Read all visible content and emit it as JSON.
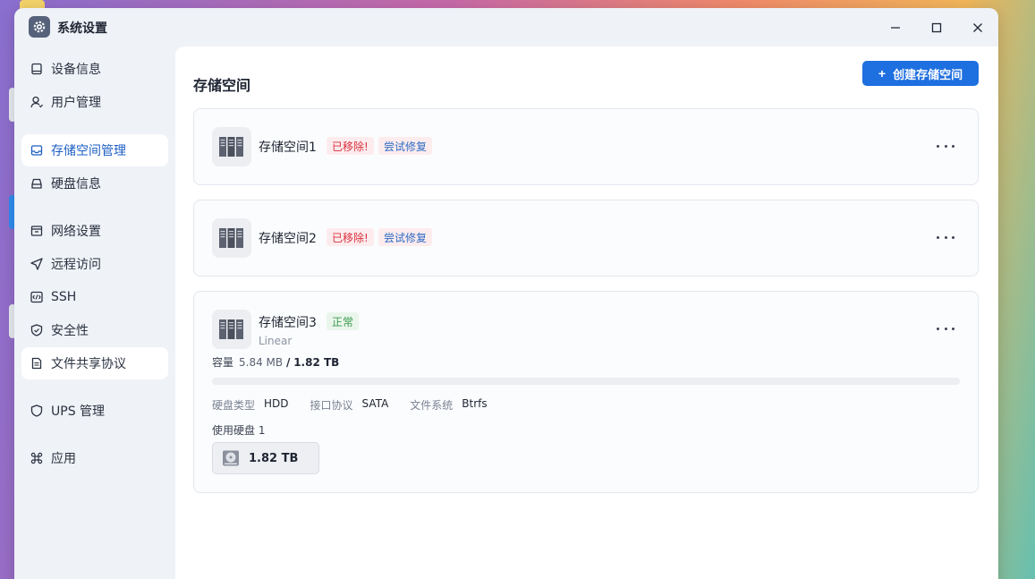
{
  "window": {
    "title": "系统设置",
    "minimize_icon": "minimize-icon",
    "maximize_icon": "maximize-icon",
    "close_icon": "close-icon"
  },
  "sidebar": {
    "items": [
      {
        "label": "设备信息",
        "icon": "device-info-icon"
      },
      {
        "label": "用户管理",
        "icon": "user-icon"
      },
      {
        "label": "存储空间管理",
        "icon": "storage-icon",
        "active": true
      },
      {
        "label": "硬盘信息",
        "icon": "disk-icon"
      },
      {
        "label": "网络设置",
        "icon": "network-icon"
      },
      {
        "label": "远程访问",
        "icon": "send-icon"
      },
      {
        "label": "SSH",
        "icon": "code-icon"
      },
      {
        "label": "安全性",
        "icon": "shield-icon"
      },
      {
        "label": "文件共享协议",
        "icon": "file-icon",
        "hover": true
      },
      {
        "label": "UPS 管理",
        "icon": "ups-shield-icon"
      },
      {
        "label": "应用",
        "icon": "command-icon"
      }
    ]
  },
  "main": {
    "title": "存储空间",
    "create_button": "创建存储空间",
    "pools": [
      {
        "name": "存储空间1",
        "status": "已移除!",
        "action": "尝试修复"
      },
      {
        "name": "存储空间2",
        "status": "已移除!",
        "action": "尝试修复"
      },
      {
        "name": "存储空间3",
        "status": "正常",
        "raid": "Linear",
        "capacity_label": "容量",
        "used": "5.84 MB",
        "separator": "/",
        "total": "1.82 TB",
        "usage_fraction": 0.0,
        "disk_type_label": "硬盘类型",
        "disk_type": "HDD",
        "interface_label": "接口协议",
        "interface": "SATA",
        "fs_label": "文件系统",
        "fs": "Btrfs",
        "disks_label": "使用硬盘 1",
        "disk_size": "1.82 TB"
      }
    ]
  },
  "colors": {
    "accent": "#1e6fe0",
    "danger": "#d9303c",
    "success": "#3c9b4e"
  }
}
